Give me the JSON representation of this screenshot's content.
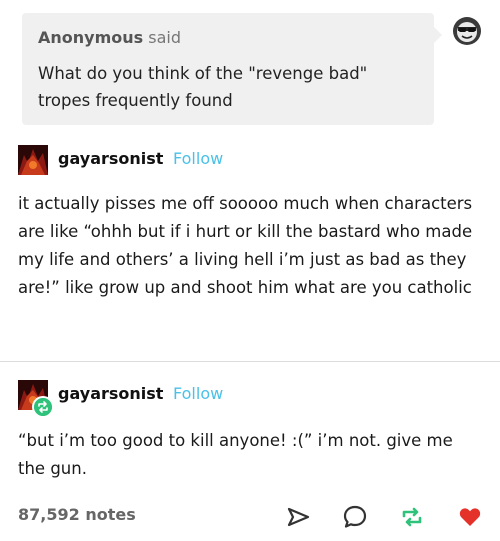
{
  "ask": {
    "asker_name": "Anonymous",
    "asker_verb": "said",
    "question": "What do you think of the \"revenge bad\" tropes frequently found"
  },
  "posts": [
    {
      "username": "gayarsonist",
      "follow_label": "Follow",
      "text": "it actually pisses me off sooooo much when characters are like “ohhh but if i hurt or kill the bastard who made my life and others’ a living hell i’m just as bad as they are!” like grow up and shoot him what are you catholic"
    },
    {
      "username": "gayarsonist",
      "follow_label": "Follow",
      "text": "“but i’m too good to kill anyone! :(” i’m not. give me the gun."
    }
  ],
  "footer": {
    "notes": "87,592 notes",
    "icons": [
      "share-icon",
      "reply-icon",
      "reblog-icon",
      "like-heart-icon"
    ]
  },
  "colors": {
    "follow": "#4ac1e8",
    "reblog": "#2fc27a",
    "like": "#e4322b",
    "ask_bg": "#f0f0f0"
  }
}
